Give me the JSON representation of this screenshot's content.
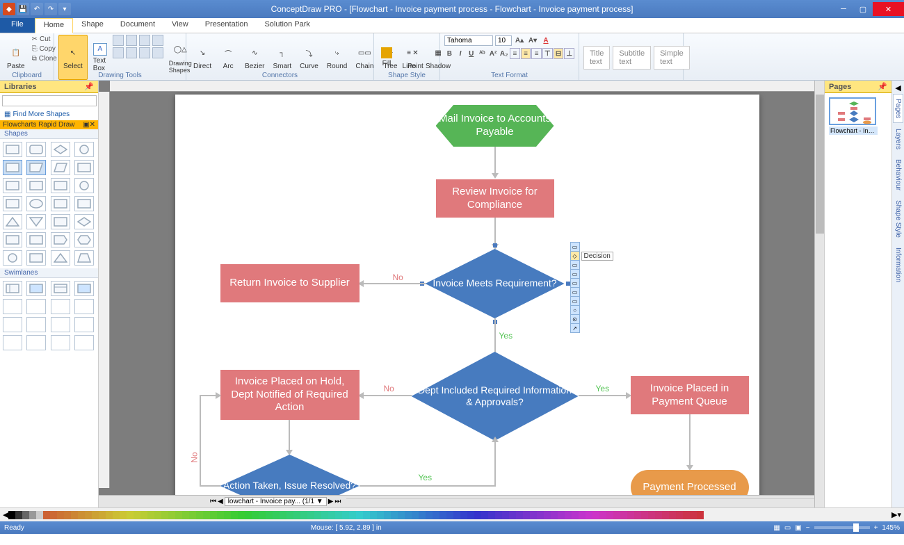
{
  "titlebar": {
    "title": "ConceptDraw PRO - [Flowchart - Invoice payment process - Flowchart - Invoice payment process]"
  },
  "menu": {
    "file": "File",
    "tabs": [
      "Home",
      "Shape",
      "Document",
      "View",
      "Presentation",
      "Solution Park"
    ],
    "active": 0
  },
  "ribbon": {
    "clipboard": {
      "label": "Clipboard",
      "paste": "Paste",
      "cut": "Cut",
      "copy": "Copy",
      "clone": "Clone"
    },
    "drawing": {
      "label": "Drawing Tools",
      "select": "Select",
      "textbox": "Text Box",
      "drawing_shapes": "Drawing Shapes"
    },
    "connectors": {
      "label": "Connectors",
      "direct": "Direct",
      "arc": "Arc",
      "bezier": "Bezier",
      "smart": "Smart",
      "curve": "Curve",
      "round": "Round",
      "chain": "Chain",
      "tree": "Tree",
      "point": "Point"
    },
    "shape_style": {
      "label": "Shape Style",
      "fill": "Fill",
      "line": "Line",
      "shadow": "Shadow"
    },
    "text_format": {
      "label": "Text Format",
      "font": "Tahoma",
      "size": "10",
      "title_text": "Title text",
      "subtitle": "Subtitle text",
      "simple": "Simple text"
    }
  },
  "libraries": {
    "title": "Libraries",
    "find_more": "Find More Shapes",
    "category": "Flowcharts Rapid Draw",
    "shapes_label": "Shapes",
    "swimlanes_label": "Swimlanes"
  },
  "pages_panel": {
    "title": "Pages",
    "thumb_caption": "Flowchart - Invoice...",
    "side_tabs": [
      "Pages",
      "Layers",
      "Behaviour",
      "Shape Style",
      "Information"
    ]
  },
  "flowchart": {
    "mail_invoice": "Mail Invoice to Accounts Payable",
    "review": "Review Invoice for Compliance",
    "meets_req": "Invoice Meets Requirement?",
    "return_supplier": "Return Invoice to Supplier",
    "dept_included": "Dept Included Required Information & Approvals?",
    "on_hold": "Invoice Placed on Hold, Dept Notified of Required Action",
    "payment_queue": "Invoice Placed in Payment Queue",
    "action_taken": "Action Taken, Issue Resolved?",
    "payment_processed": "Payment Processed",
    "no": "No",
    "yes": "Yes",
    "decision_tooltip": "Decision"
  },
  "page_tab": {
    "label": "lowchart - Invoice pay...  (1/1"
  },
  "status": {
    "ready": "Ready",
    "mouse": "Mouse: [ 5.92, 2.89 ] in",
    "zoom": "145%"
  }
}
